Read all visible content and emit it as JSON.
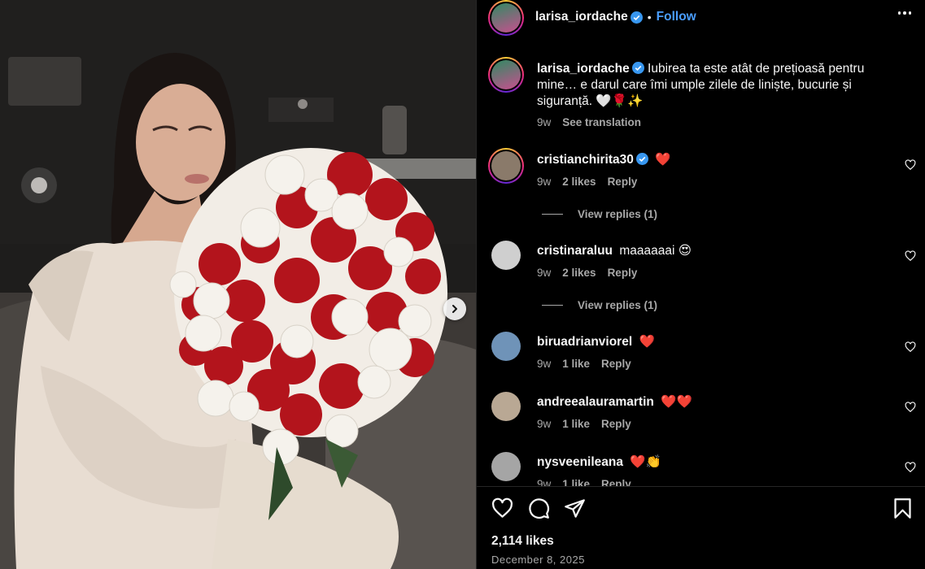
{
  "post": {
    "author": "larisa_iordache",
    "follow_label": "Follow",
    "separator": "•",
    "caption": "Iubirea ta este atât de prețioasă pentru mine… e darul care îmi umple zilele de liniște, bucurie și siguranță. 🤍🌹✨",
    "caption_age": "9w",
    "see_translation": "See translation",
    "likes": "2,114 likes",
    "date": "December 8, 2025"
  },
  "comments": [
    {
      "user": "cristianchirita30",
      "verified": true,
      "text": "❤️",
      "age": "9w",
      "likes": "2 likes",
      "reply": "Reply",
      "view_replies": "View replies (1)",
      "avatar_color": "#8a7a6a"
    },
    {
      "user": "cristinaraluu",
      "verified": false,
      "text": "maaaaaai 😍",
      "age": "9w",
      "likes": "2 likes",
      "reply": "Reply",
      "view_replies": "View replies (1)",
      "avatar_color": "#cfcfcf"
    },
    {
      "user": "biruadrianviorel",
      "verified": false,
      "text": "❤️",
      "age": "9w",
      "likes": "1 like",
      "reply": "Reply",
      "avatar_color": "#6f93b8"
    },
    {
      "user": "andreealauramartin",
      "verified": false,
      "text": "❤️❤️",
      "age": "9w",
      "likes": "1 like",
      "reply": "Reply",
      "avatar_color": "#b9a894"
    },
    {
      "user": "nysveenileana",
      "verified": false,
      "text": "❤️👏",
      "age": "9w",
      "likes": "1 like",
      "reply": "Reply",
      "avatar_color": "#a5a5a5"
    }
  ],
  "colors": {
    "accent": "#4a9eff",
    "verified": "#3897f0",
    "muted": "#a8a8a8"
  }
}
